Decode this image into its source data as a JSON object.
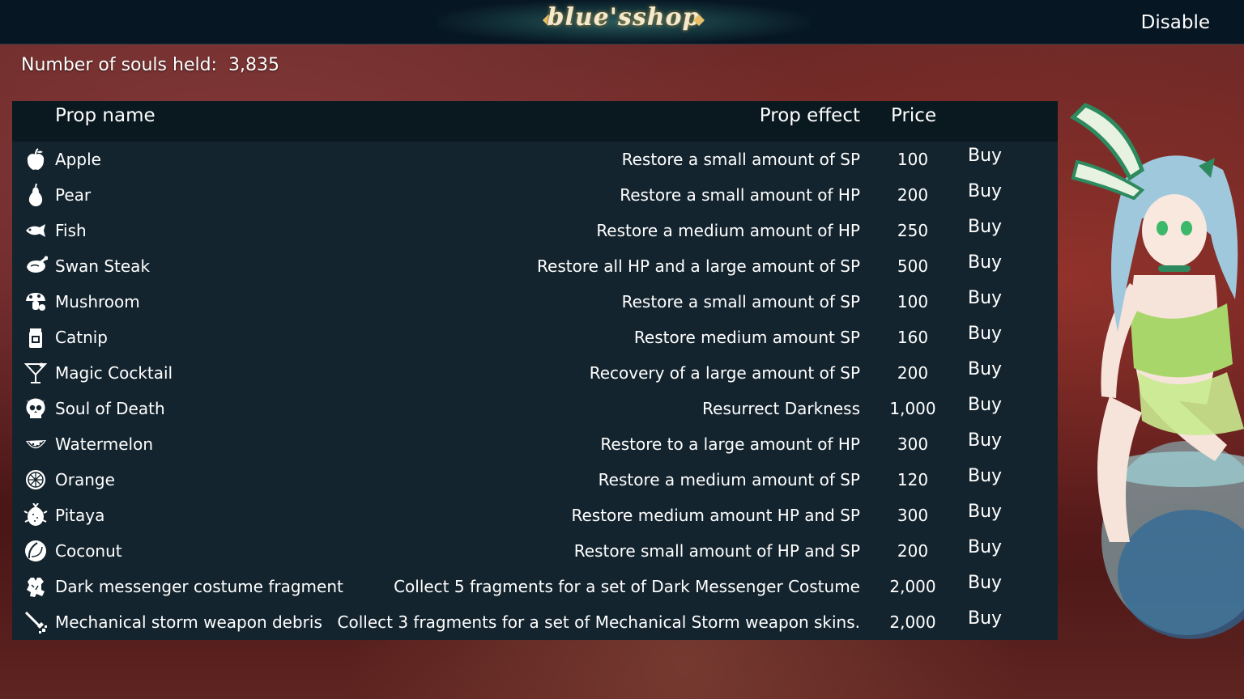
{
  "header": {
    "logo_text": "blue'sshop",
    "disable_label": "Disable"
  },
  "souls": {
    "label": "Number of souls held:",
    "value": "3,835"
  },
  "table": {
    "columns": {
      "name": "Prop name",
      "effect": "Prop effect",
      "price": "Price"
    },
    "buy_label": "Buy",
    "rows": [
      {
        "icon": "apple-icon",
        "name": "Apple",
        "effect": "Restore a small amount of SP",
        "price": "100"
      },
      {
        "icon": "pear-icon",
        "name": "Pear",
        "effect": "Restore a small amount of HP",
        "price": "200"
      },
      {
        "icon": "fish-icon",
        "name": "Fish",
        "effect": "Restore a medium amount of HP",
        "price": "250"
      },
      {
        "icon": "steak-icon",
        "name": "Swan Steak",
        "effect": "Restore all HP and a large amount of SP",
        "price": "500"
      },
      {
        "icon": "mushroom-icon",
        "name": "Mushroom",
        "effect": "Restore a small amount of SP",
        "price": "100"
      },
      {
        "icon": "catnip-icon",
        "name": "Catnip",
        "effect": "Restore medium amount SP",
        "price": "160"
      },
      {
        "icon": "cocktail-icon",
        "name": "Magic Cocktail",
        "effect": "Recovery of a large amount of SP",
        "price": "200"
      },
      {
        "icon": "skull-icon",
        "name": "Soul of Death",
        "effect": "Resurrect Darkness",
        "price": "1,000"
      },
      {
        "icon": "watermelon-icon",
        "name": "Watermelon",
        "effect": "Restore to a large amount of HP",
        "price": "300"
      },
      {
        "icon": "orange-icon",
        "name": "Orange",
        "effect": "Restore a medium amount of SP",
        "price": "120"
      },
      {
        "icon": "pitaya-icon",
        "name": "Pitaya",
        "effect": "Restore medium amount HP and SP",
        "price": "300"
      },
      {
        "icon": "coconut-icon",
        "name": "Coconut",
        "effect": "Restore small amount of HP and SP",
        "price": "200"
      },
      {
        "icon": "costume-fragment-icon",
        "name": "Dark messenger costume fragment",
        "effect": "Collect 5 fragments for a set of Dark Messenger Costume",
        "price": "2,000"
      },
      {
        "icon": "weapon-debris-icon",
        "name": "Mechanical storm weapon debris",
        "effect": "Collect 3 fragments for a set of Mechanical Storm weapon skins.",
        "price": "2,000"
      }
    ]
  }
}
